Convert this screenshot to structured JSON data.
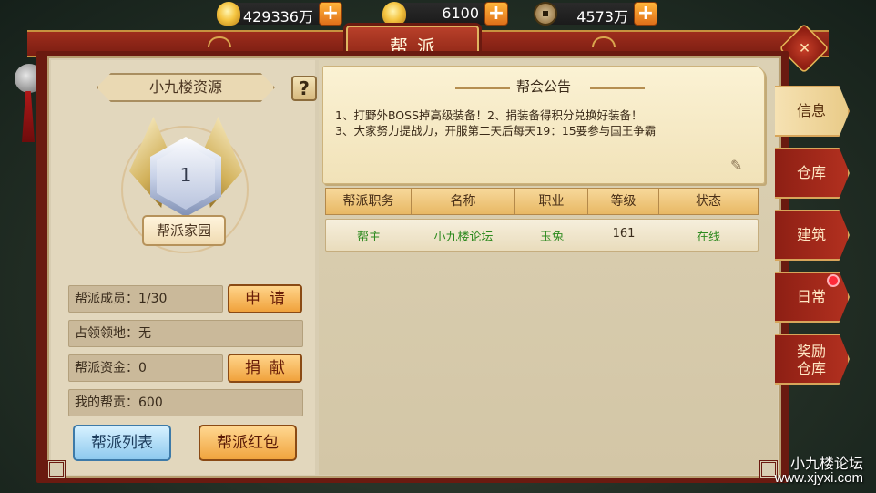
{
  "currency": {
    "gold_ingot": "429336万",
    "gold_ingot_alt": "6100",
    "copper_coin": "4573万"
  },
  "header": {
    "title": "帮派"
  },
  "resources": {
    "label": "小九楼资源",
    "help_label": "?",
    "emblem_level": "1",
    "emblem_name": "帮派家园"
  },
  "stats": {
    "members": "帮派成员：1/30",
    "territory": "占领领地：无",
    "funds": "帮派资金：0",
    "contribution": "我的帮贡：600"
  },
  "buttons": {
    "apply": "申请",
    "donate": "捐献",
    "guild_list": "帮派列表",
    "red_packet": "帮派红包"
  },
  "notice": {
    "title": "帮会公告",
    "lines": [
      "1、打野外BOSS掉高级装备！2、捐装备得积分兑换好装备！",
      "3、大家努力提战力，开服第二天后每天19：15要参与国王争霸"
    ]
  },
  "table": {
    "columns": [
      "帮派职务",
      "名称",
      "职业",
      "等级",
      "状态"
    ],
    "rows": [
      {
        "role": "帮主",
        "name": "小九楼论坛",
        "job": "玉兔",
        "level": "161",
        "status": "在线"
      }
    ]
  },
  "side_tabs": [
    {
      "label": "信息",
      "active": true
    },
    {
      "label": "仓库",
      "active": false
    },
    {
      "label": "建筑",
      "active": false
    },
    {
      "label": "日常",
      "active": false,
      "badge": true
    },
    {
      "label": "奖励",
      "label2": "仓库",
      "active": false
    }
  ],
  "watermark": {
    "line1": "小九楼论坛",
    "line2": "www.xjyxi.com"
  },
  "colors": {
    "frame_red": "#8f1e12",
    "parchment": "#d8cdb2",
    "text_green": "#2e8a1f",
    "button_orange": "#f0a23c",
    "button_blue": "#8ec9ee"
  }
}
